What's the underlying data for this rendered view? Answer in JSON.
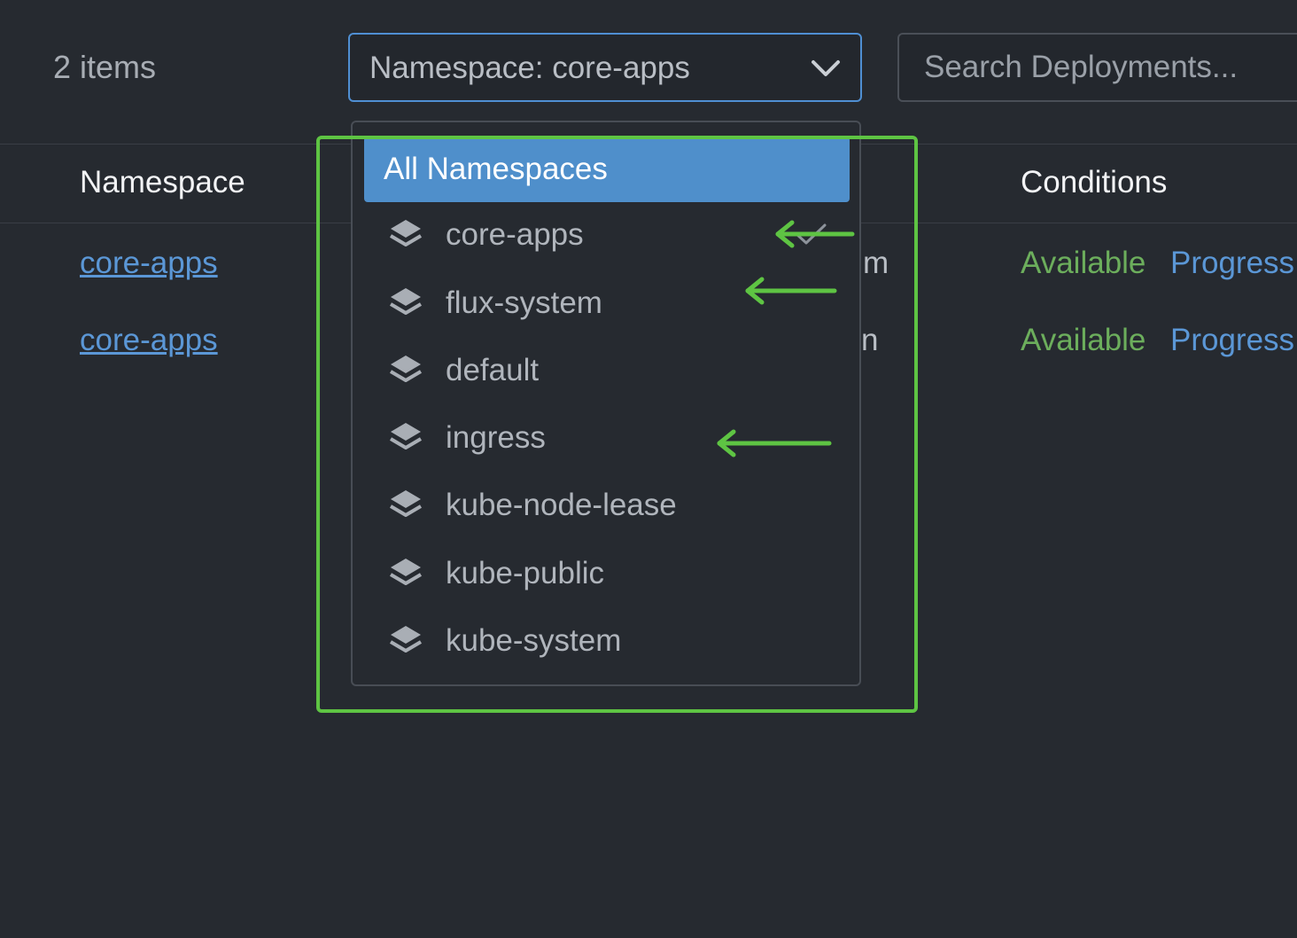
{
  "toolbar": {
    "item_count": "2 items",
    "namespace_select_value": "Namespace: core-apps",
    "search_placeholder": "Search Deployments..."
  },
  "table": {
    "headers": {
      "namespace": "Namespace",
      "conditions": "Conditions"
    },
    "rows": [
      {
        "namespace": "core-apps",
        "partial_cell": "m",
        "condition_available": "Available",
        "condition_progress": "Progress"
      },
      {
        "namespace": "core-apps",
        "partial_cell": "n",
        "condition_available": "Available",
        "condition_progress": "Progress"
      }
    ]
  },
  "dropdown": {
    "selected_option": "All Namespaces",
    "options": [
      {
        "label": "core-apps",
        "icon": "layers-icon",
        "checked": true
      },
      {
        "label": "flux-system",
        "icon": "layers-icon",
        "checked": false
      },
      {
        "label": "default",
        "icon": "layers-icon",
        "checked": false
      },
      {
        "label": "ingress",
        "icon": "layers-icon",
        "checked": false
      },
      {
        "label": "kube-node-lease",
        "icon": "layers-icon",
        "checked": false
      },
      {
        "label": "kube-public",
        "icon": "layers-icon",
        "checked": false
      },
      {
        "label": "kube-system",
        "icon": "layers-icon",
        "checked": false
      }
    ]
  },
  "colors": {
    "background": "#262a30",
    "accent_blue": "#4f8fcb",
    "link_blue": "#5b97d6",
    "available_green": "#6cae5c",
    "annotation_green": "#5ec443"
  }
}
